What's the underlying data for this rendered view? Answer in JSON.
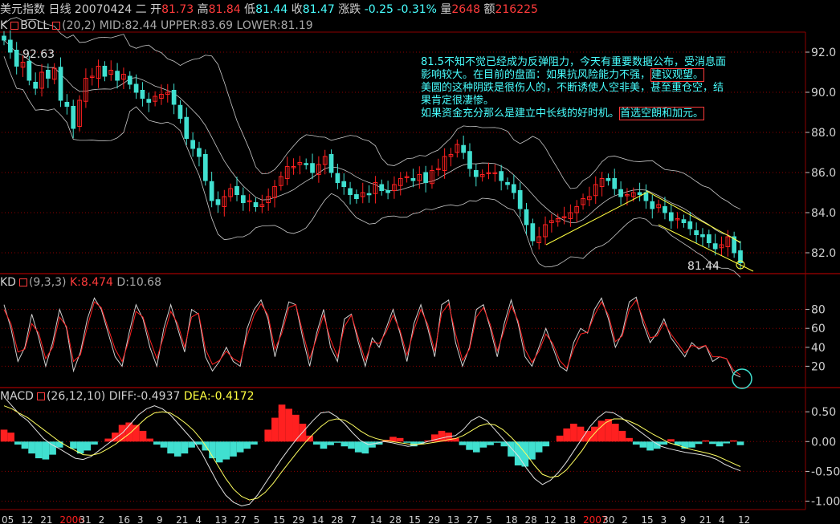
{
  "header": {
    "symbol": "美元指数",
    "period": "日线",
    "date": "20070424",
    "weekday": "二",
    "open_label": "开",
    "open": "81.73",
    "high_label": "高",
    "high": "81.84",
    "low_label": "低",
    "low": "81.44",
    "close_label": "收",
    "close": "81.47",
    "change_label": "涨跌",
    "change": "-0.25",
    "change_pct": "-0.31%",
    "volume_label": "量",
    "volume": "2648",
    "amount_label": "额",
    "amount": "216225"
  },
  "boll_panel": {
    "title": "K",
    "indicator": "BOLL",
    "params": "(20,2)",
    "mid_label": "MID:",
    "mid": "82.44",
    "upper_label": "UPPER:",
    "upper": "83.69",
    "lower_label": "LOWER:",
    "lower": "81.19",
    "high_marker": "92.63",
    "low_marker": "81.44"
  },
  "annotation": {
    "line1": "81.5不知不觉已经成为反弹阻力，今天有重要数据公布，受消息面影响较大。在目前的盘面：如果抗风险能力不强，",
    "line1_box": "建议观望。",
    "line2": "美圆的这种阴跌是很伤人的，不断诱使人空非美，甚至重仓空，结果肯定很凄惨。",
    "line3": "如果资金充分那么是建立中长线的好时机。",
    "line3_box": "首选空朗和加元。"
  },
  "kd_panel": {
    "title": "KD",
    "params": "(9,3,3)",
    "k_label": "K:",
    "k": "8.474",
    "d_label": "D:",
    "d": "10.68"
  },
  "macd_panel": {
    "title": "MACD",
    "params": "(26,12,10)",
    "diff_label": "DIFF:",
    "diff": "-0.4937",
    "dea_label": "DEA:",
    "dea": "-0.4172"
  },
  "x_axis_labels": [
    "05",
    "12",
    "21",
    "2006",
    "31",
    "2",
    "16",
    "3",
    "9",
    "21",
    "4",
    "13",
    "27",
    "5",
    "15",
    "29",
    "14",
    "28",
    "7",
    "14",
    "28",
    "15",
    "29",
    "13",
    "27",
    "5",
    "18",
    "28",
    "12",
    "18",
    "2007",
    "30",
    "2",
    "15",
    "3",
    "9",
    "21",
    "4",
    "12"
  ],
  "colors": {
    "up": "#ff2020",
    "down": "#40e0d0",
    "boll": "#c8c8c8",
    "k_line": "#d0d0d0",
    "d_line": "#ff2020",
    "dea": "#ffff60",
    "trend": "#ffff40",
    "grid": "#8b0000"
  },
  "chart_data": [
    {
      "type": "candlestick",
      "title": "BOLL (20,2)",
      "ylim": [
        81.0,
        93.0
      ],
      "yticks": [
        "92.0",
        "90.0",
        "88.0",
        "86.0",
        "84.0",
        "82.0"
      ],
      "close_path": [
        92.6,
        92.0,
        91.3,
        91.5,
        90.6,
        90.2,
        91.0,
        90.7,
        91.2,
        89.6,
        89.3,
        88.2,
        89.6,
        90.7,
        90.8,
        91.3,
        90.8,
        91.1,
        90.6,
        90.9,
        90.4,
        90.0,
        89.7,
        89.5,
        89.8,
        89.9,
        90.0,
        89.4,
        88.7,
        87.7,
        87.2,
        86.8,
        85.6,
        84.6,
        84.4,
        84.8,
        85.2,
        84.9,
        84.5,
        84.6,
        84.3,
        84.4,
        84.8,
        85.3,
        85.8,
        86.3,
        86.3,
        86.5,
        86.4,
        86.0,
        86.4,
        86.8,
        86.0,
        85.5,
        85.3,
        84.9,
        84.7,
        85.0,
        84.9,
        85.5,
        85.1,
        85.0,
        85.4,
        85.7,
        85.8,
        85.6,
        85.9,
        85.5,
        86.1,
        86.2,
        86.8,
        86.9,
        87.4,
        87.0,
        86.2,
        85.8,
        85.9,
        86.0,
        86.0,
        85.6,
        85.4,
        85.0,
        84.2,
        83.4,
        82.6,
        82.8,
        83.4,
        83.6,
        83.7,
        83.8,
        84.0,
        84.3,
        84.7,
        84.8,
        85.4,
        85.7,
        85.6,
        85.2,
        84.8,
        84.9,
        85.0,
        84.9,
        84.6,
        84.2,
        84.4,
        84.0,
        83.6,
        83.7,
        83.5,
        83.2,
        82.9,
        82.8,
        82.5,
        82.2,
        82.4,
        82.8,
        82.0,
        81.5
      ],
      "note": "values estimated from price axis"
    },
    {
      "type": "line",
      "title": "KD (9,3,3)",
      "ylim": [
        0,
        100
      ],
      "yticks": [
        "80",
        "60",
        "40",
        "20"
      ],
      "series": [
        {
          "name": "K",
          "values": [
            85,
            60,
            25,
            40,
            75,
            50,
            20,
            45,
            80,
            60,
            15,
            35,
            70,
            92,
            80,
            55,
            30,
            20,
            55,
            85,
            70,
            40,
            20,
            60,
            85,
            60,
            35,
            80,
            75,
            30,
            15,
            25,
            40,
            25,
            20,
            60,
            80,
            90,
            70,
            30,
            60,
            88,
            85,
            50,
            20,
            55,
            80,
            40,
            25,
            70,
            75,
            45,
            20,
            50,
            40,
            60,
            80,
            55,
            25,
            65,
            85,
            60,
            30,
            85,
            90,
            45,
            20,
            40,
            80,
            85,
            60,
            30,
            65,
            90,
            65,
            30,
            20,
            40,
            60,
            40,
            20,
            15,
            45,
            60,
            55,
            80,
            92,
            70,
            40,
            55,
            88,
            93,
            65,
            45,
            55,
            70,
            50,
            40,
            30,
            45,
            38,
            42,
            25,
            30,
            28,
            12,
            8.5
          ]
        },
        {
          "name": "D",
          "values": [
            80,
            65,
            35,
            38,
            65,
            55,
            28,
            40,
            72,
            62,
            25,
            32,
            62,
            88,
            82,
            60,
            38,
            25,
            48,
            78,
            72,
            48,
            28,
            52,
            78,
            65,
            40,
            72,
            76,
            38,
            22,
            26,
            36,
            28,
            24,
            52,
            74,
            86,
            74,
            38,
            55,
            82,
            85,
            56,
            28,
            50,
            74,
            48,
            30,
            62,
            74,
            50,
            26,
            46,
            44,
            56,
            74,
            58,
            32,
            58,
            80,
            64,
            36,
            76,
            86,
            54,
            26,
            38,
            72,
            82,
            64,
            36,
            58,
            84,
            68,
            38,
            24,
            36,
            54,
            44,
            26,
            18,
            38,
            54,
            56,
            74,
            88,
            74,
            46,
            52,
            80,
            90,
            70,
            50,
            52,
            66,
            54,
            44,
            34,
            42,
            40,
            42,
            30,
            30,
            28,
            16,
            10.7
          ]
        }
      ]
    },
    {
      "type": "bar",
      "title": "MACD (26,12,10)",
      "ylim": [
        -1.1,
        0.65
      ],
      "yticks": [
        "0.50",
        "0.00",
        "-0.50",
        "-1.00"
      ],
      "values": [
        0.2,
        0.15,
        -0.05,
        -0.12,
        -0.2,
        -0.28,
        -0.3,
        -0.22,
        -0.1,
        0.0,
        -0.12,
        -0.2,
        -0.15,
        -0.05,
        0.0,
        0.05,
        0.15,
        0.28,
        0.32,
        0.28,
        0.18,
        0.05,
        -0.05,
        -0.1,
        -0.2,
        -0.25,
        -0.2,
        -0.1,
        -0.05,
        -0.15,
        -0.28,
        -0.35,
        -0.3,
        -0.25,
        -0.18,
        -0.12,
        -0.05,
        0.0,
        0.2,
        0.4,
        0.62,
        0.55,
        0.45,
        0.3,
        0.1,
        -0.05,
        -0.12,
        -0.06,
        -0.02,
        -0.08,
        -0.12,
        -0.18,
        -0.2,
        -0.1,
        -0.05,
        0.03,
        0.08,
        0.06,
        -0.02,
        -0.08,
        -0.04,
        0.02,
        0.12,
        0.18,
        0.15,
        0.06,
        -0.06,
        -0.14,
        -0.18,
        -0.1,
        -0.06,
        -0.02,
        -0.08,
        -0.25,
        -0.4,
        -0.42,
        -0.3,
        -0.18,
        -0.08,
        0.0,
        0.1,
        0.22,
        0.3,
        0.25,
        0.18,
        0.25,
        0.35,
        0.38,
        0.3,
        0.18,
        0.06,
        -0.05,
        -0.1,
        -0.15,
        -0.12,
        -0.05,
        0.04,
        -0.06,
        -0.12,
        -0.1,
        -0.04,
        0.02,
        -0.04,
        -0.08,
        -0.03,
        0.02,
        -0.06
      ],
      "series": [
        {
          "name": "DIFF",
          "values": [
            0.75,
            0.6,
            0.45,
            0.35,
            0.2,
            0.05,
            -0.05,
            -0.12,
            -0.2,
            -0.28,
            -0.3,
            -0.25,
            -0.15,
            -0.05,
            0.05,
            0.15,
            0.3,
            0.45,
            0.55,
            0.6,
            0.55,
            0.45,
            0.3,
            0.15,
            0.0,
            -0.2,
            -0.45,
            -0.7,
            -0.9,
            -1.02,
            -1.08,
            -1.05,
            -0.9,
            -0.7,
            -0.5,
            -0.3,
            -0.12,
            0.05,
            0.2,
            0.35,
            0.48,
            0.5,
            0.42,
            0.3,
            0.15,
            0.02,
            -0.05,
            -0.03,
            0.0,
            -0.02,
            -0.05,
            -0.08,
            -0.06,
            -0.02,
            0.02,
            0.05,
            0.08,
            0.1,
            0.2,
            0.35,
            0.42,
            0.35,
            0.2,
            0.05,
            -0.1,
            -0.25,
            -0.45,
            -0.62,
            -0.72,
            -0.65,
            -0.52,
            -0.35,
            -0.15,
            0.05,
            0.25,
            0.4,
            0.5,
            0.48,
            0.4,
            0.3,
            0.2,
            0.1,
            0.0,
            -0.08,
            -0.12,
            -0.15,
            -0.18,
            -0.2,
            -0.22,
            -0.25,
            -0.3,
            -0.38,
            -0.44,
            -0.49
          ]
        },
        {
          "name": "DEA",
          "values": [
            0.6,
            0.55,
            0.47,
            0.4,
            0.3,
            0.2,
            0.1,
            0.0,
            -0.08,
            -0.15,
            -0.22,
            -0.23,
            -0.2,
            -0.13,
            -0.05,
            0.05,
            0.15,
            0.28,
            0.4,
            0.48,
            0.5,
            0.48,
            0.4,
            0.3,
            0.18,
            0.02,
            -0.18,
            -0.4,
            -0.62,
            -0.8,
            -0.92,
            -0.98,
            -0.95,
            -0.85,
            -0.7,
            -0.52,
            -0.35,
            -0.18,
            -0.02,
            0.12,
            0.25,
            0.35,
            0.38,
            0.36,
            0.28,
            0.18,
            0.1,
            0.05,
            0.02,
            0.0,
            -0.02,
            -0.04,
            -0.05,
            -0.04,
            -0.02,
            0.0,
            0.03,
            0.05,
            0.1,
            0.18,
            0.26,
            0.3,
            0.28,
            0.2,
            0.08,
            -0.06,
            -0.22,
            -0.4,
            -0.55,
            -0.6,
            -0.58,
            -0.48,
            -0.32,
            -0.15,
            0.05,
            0.2,
            0.32,
            0.38,
            0.38,
            0.34,
            0.28,
            0.2,
            0.12,
            0.05,
            -0.02,
            -0.06,
            -0.1,
            -0.14,
            -0.17,
            -0.2,
            -0.24,
            -0.3,
            -0.36,
            -0.42
          ]
        }
      ]
    }
  ]
}
